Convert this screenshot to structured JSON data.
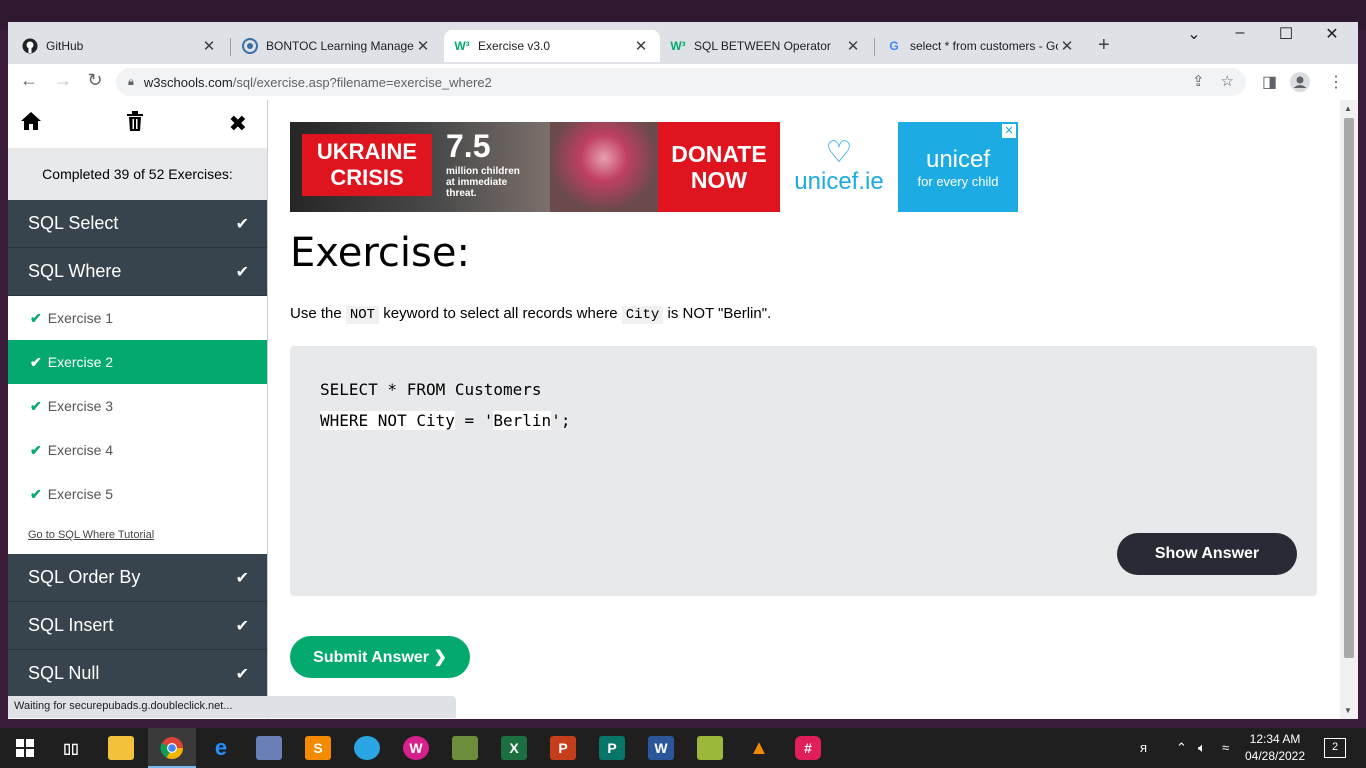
{
  "browser": {
    "tabs": [
      {
        "title": "GitHub",
        "icon": "github-icon"
      },
      {
        "title": "BONTOC Learning Managem",
        "icon": "moodle-icon"
      },
      {
        "title": "Exercise v3.0",
        "icon": "w3schools-icon"
      },
      {
        "title": "SQL BETWEEN Operator",
        "icon": "w3schools-icon"
      },
      {
        "title": "select * from customers - Go",
        "icon": "google-icon"
      }
    ],
    "active_tab": 2,
    "url_host": "w3schools.com",
    "url_path": "/sql/exercise.asp?filename=exercise_where2",
    "status_text": "Waiting for securepubads.g.doubleclick.net..."
  },
  "sidebar": {
    "completed": "Completed 39 of 52 Exercises:",
    "sections_top": [
      {
        "label": "SQL Select"
      },
      {
        "label": "SQL Where"
      }
    ],
    "exercises": [
      {
        "label": "Exercise 1"
      },
      {
        "label": "Exercise 2"
      },
      {
        "label": "Exercise 3"
      },
      {
        "label": "Exercise 4"
      },
      {
        "label": "Exercise 5"
      }
    ],
    "active_exercise": 1,
    "tutorial_link": "Go to SQL Where Tutorial",
    "sections_bottom": [
      {
        "label": "SQL Order By"
      },
      {
        "label": "SQL Insert"
      },
      {
        "label": "SQL Null"
      }
    ]
  },
  "ad": {
    "headline_1": "UKRAINE",
    "headline_2": "CRISIS",
    "number": "7.5",
    "subtext_1": "million children",
    "subtext_2": "at immediate",
    "subtext_3": "threat.",
    "donate_1": "DONATE",
    "donate_2": "NOW",
    "site": "unicef.ie",
    "brand": "unicef",
    "tagline": "for every child",
    "close": "✕"
  },
  "exercise": {
    "heading": "Exercise:",
    "instruction_pre": "Use the",
    "keyword": "NOT",
    "instruction_mid": "keyword to select all records where",
    "field": "City",
    "instruction_post": "is NOT \"Berlin\".",
    "code_line1": "SELECT * FROM Customers",
    "code_input1": "WHERE NOT City",
    "code_eq": " = '",
    "code_input2": "Berlin",
    "code_end": "';",
    "show_answer": "Show Answer",
    "submit": "Submit Answer ❯"
  },
  "taskbar": {
    "time": "12:34 AM",
    "date": "04/28/2022",
    "notifications": "2"
  },
  "colors": {
    "w3_green": "#04aa6d",
    "sidebar_dark": "#38444d",
    "button_dark": "#282a35",
    "code_bg": "#e7e9eb"
  }
}
